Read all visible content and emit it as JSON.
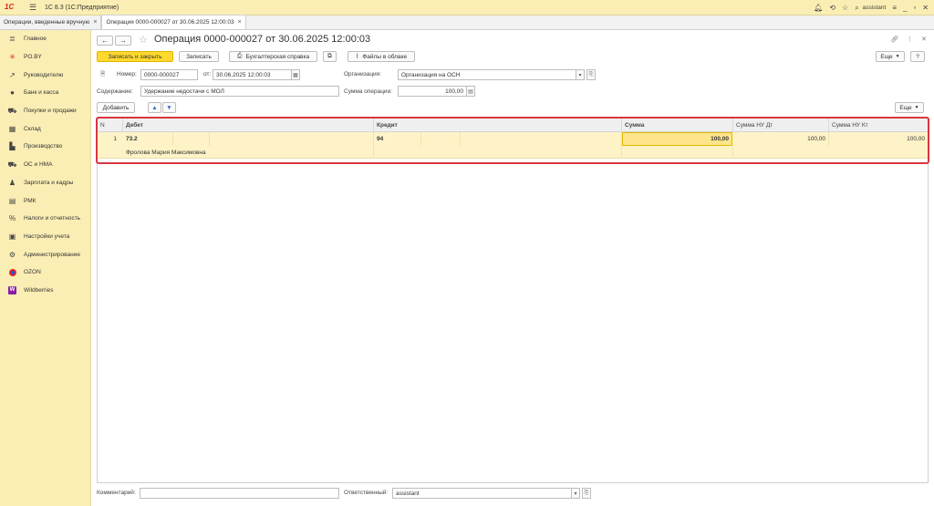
{
  "titlebar": {
    "logo": "1С",
    "title": "1С 8.3  (1С:Предприятие)",
    "user": "assistant"
  },
  "tabs": [
    {
      "label": "Операции, введенные вручную"
    },
    {
      "label": "Операция 0000-000027 от 30.06.2025 12:00:03"
    }
  ],
  "sidebar": {
    "items": [
      {
        "label": "Главное",
        "icon": "menu-icon"
      },
      {
        "label": "PO.BY",
        "icon": "star-burst-icon"
      },
      {
        "label": "Руководителю",
        "icon": "chart-line-icon"
      },
      {
        "label": "Банк и касса",
        "icon": "coin-icon"
      },
      {
        "label": "Покупки и продажи",
        "icon": "cart-icon"
      },
      {
        "label": "Склад",
        "icon": "warehouse-icon"
      },
      {
        "label": "Производство",
        "icon": "factory-icon"
      },
      {
        "label": "ОС и НМА",
        "icon": "truck-icon"
      },
      {
        "label": "Зарплата и кадры",
        "icon": "person-icon"
      },
      {
        "label": "РМК",
        "icon": "register-icon"
      },
      {
        "label": "Налоги и отчетность",
        "icon": "percent-icon"
      },
      {
        "label": "Настройки учета",
        "icon": "document-settings-icon"
      },
      {
        "label": "Администрирование",
        "icon": "gear-icon"
      },
      {
        "label": "OZON",
        "icon": "ozon-logo-icon"
      },
      {
        "label": "Wildberries",
        "icon": "wildberries-logo-icon"
      }
    ]
  },
  "form": {
    "title": "Операция 0000-000027 от 30.06.2025 12:00:03",
    "toolbar": {
      "save_close": "Записать и закрыть",
      "save": "Записать",
      "accounting_report": "Бухгалтерская справка",
      "cloud_files": "Файлы в облаке",
      "more": "Еще"
    },
    "number_label": "Номер:",
    "number_value": "0000-000027",
    "date_label": "от:",
    "date_value": "30.06.2025 12:00:03",
    "org_label": "Организация:",
    "org_value": "Организация на ОСН",
    "content_label": "Содержание:",
    "content_value": "Удержание недостачи с МОЛ",
    "amount_label": "Сумма операции:",
    "amount_value": "100,00",
    "add_button": "Добавить",
    "table_more": "Еще",
    "table": {
      "headers": {
        "n": "N",
        "debit": "Дебет",
        "credit": "Кредит",
        "sum": "Сумма",
        "sum_nu_dt": "Сумма НУ Дт",
        "sum_nu_kt": "Сумма НУ Кт"
      },
      "rows": [
        {
          "n": "1",
          "debit_account": "73.2",
          "debit_subconto": "Фролова Мария Максимовна",
          "credit_account": "94",
          "sum": "100,00",
          "sum_nu_dt": "100,00",
          "sum_nu_kt": "100,00"
        }
      ]
    },
    "comment_label": "Комментарий:",
    "comment_value": "",
    "responsible_label": "Ответственный:",
    "responsible_value": "assistant"
  }
}
